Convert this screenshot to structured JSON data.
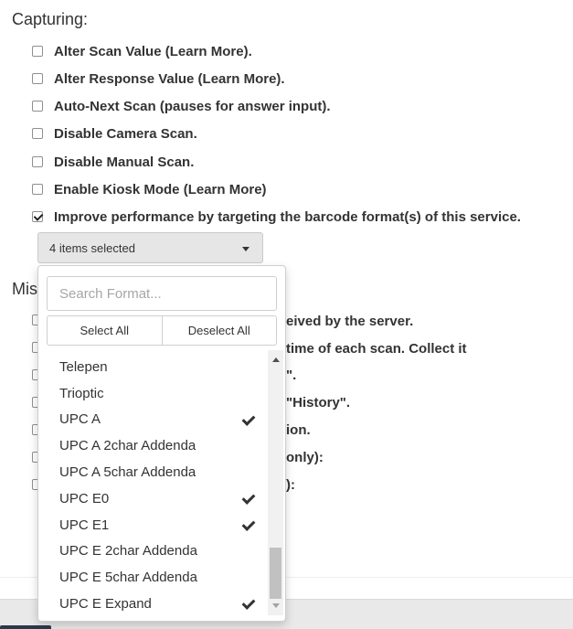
{
  "capturing": {
    "title": "Capturing:",
    "options": [
      {
        "label": "Alter Scan Value (Learn More).",
        "checked": false
      },
      {
        "label": "Alter Response Value (Learn More).",
        "checked": false
      },
      {
        "label": "Auto-Next Scan (pauses for answer input).",
        "checked": false
      },
      {
        "label": "Disable Camera Scan.",
        "checked": false
      },
      {
        "label": "Disable Manual Scan.",
        "checked": false
      },
      {
        "label": "Enable Kiosk Mode (Learn More)",
        "checked": false
      },
      {
        "label": "Improve performance by targeting the barcode format(s) of this service.",
        "checked": true
      }
    ]
  },
  "format_select": {
    "value": "4 items selected"
  },
  "dropdown": {
    "search_placeholder": "Search Format...",
    "select_all": "Select All",
    "deselect_all": "Deselect All",
    "items": [
      {
        "label": "Telepen",
        "selected": false
      },
      {
        "label": "Trioptic",
        "selected": false
      },
      {
        "label": "UPC A",
        "selected": true
      },
      {
        "label": "UPC A 2char Addenda",
        "selected": false
      },
      {
        "label": "UPC A 5char Addenda",
        "selected": false
      },
      {
        "label": "UPC E0",
        "selected": true
      },
      {
        "label": "UPC E1",
        "selected": true
      },
      {
        "label": "UPC E 2char Addenda",
        "selected": false
      },
      {
        "label": "UPC E 5char Addenda",
        "selected": false
      },
      {
        "label": "UPC E Expand",
        "selected": true
      }
    ],
    "scroll_fraction": 0.75
  },
  "misc": {
    "title_partial": "Mis",
    "partial_texts": [
      "eived by the server.",
      "time of each scan. Collect it",
      "\".",
      "\"History\".",
      "ion.",
      "only):",
      "):"
    ]
  }
}
